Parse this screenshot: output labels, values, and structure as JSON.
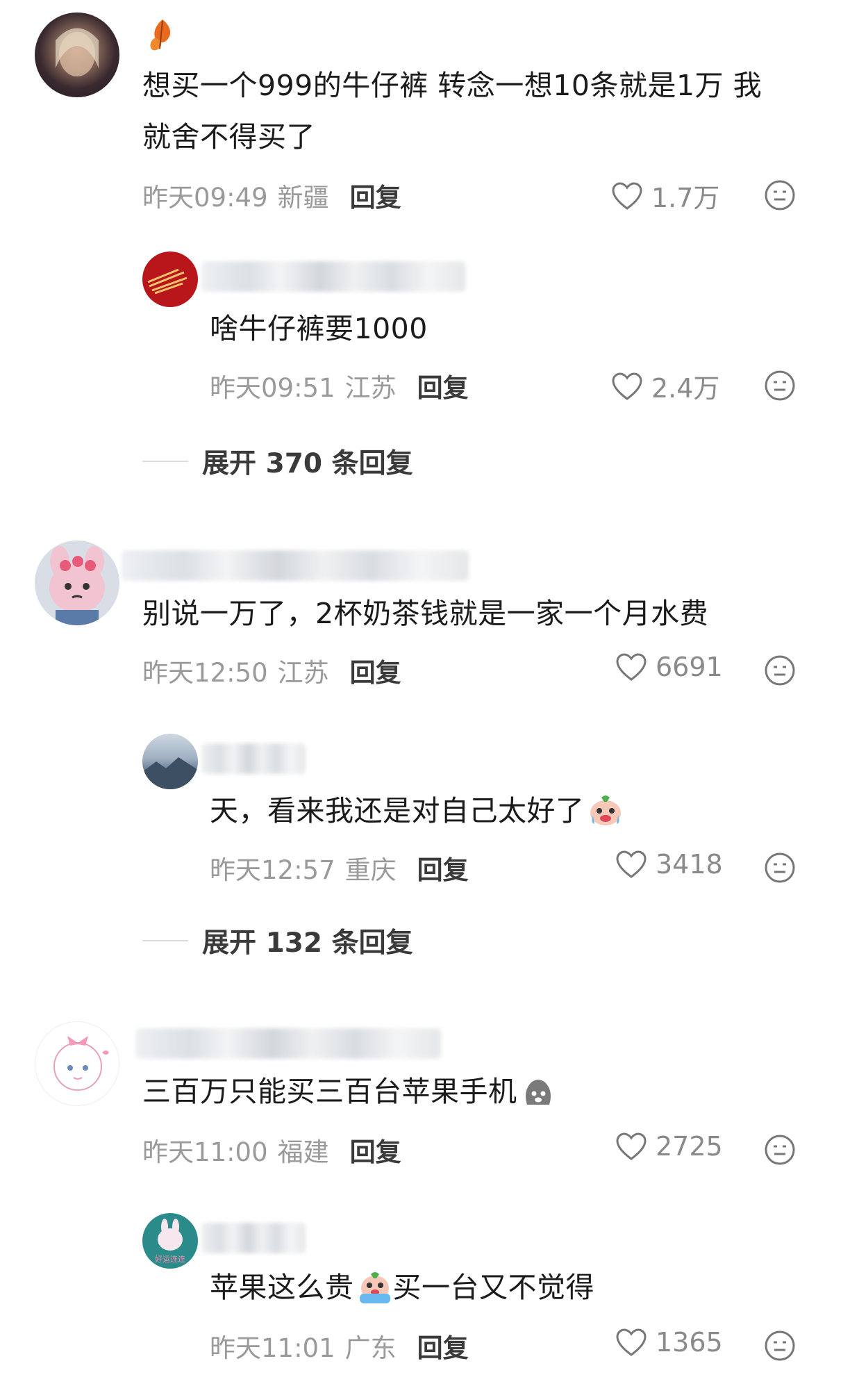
{
  "comments": [
    {
      "text": "想买一个999的牛仔裤 转念一想10条就是1万 我就舍不得买了",
      "line1": "想买一个999的牛仔裤 转念一想10条就是1万 我",
      "line2": "就舍不得买了",
      "time": "昨天09:49",
      "location": "新疆",
      "reply_label": "回复",
      "likes": "1.7万",
      "reply": {
        "text": "啥牛仔裤要1000",
        "time": "昨天09:51",
        "location": "江苏",
        "reply_label": "回复",
        "likes": "2.4万"
      },
      "expand_label": "展开 370 条回复"
    },
    {
      "text": "别说一万了，2杯奶茶钱就是一家一个月水费",
      "time": "昨天12:50",
      "location": "江苏",
      "reply_label": "回复",
      "likes": "6691",
      "reply": {
        "text": "天，看来我还是对自己太好了",
        "time": "昨天12:57",
        "location": "重庆",
        "reply_label": "回复",
        "likes": "3418"
      },
      "expand_label": "展开 132 条回复"
    },
    {
      "text": "三百万只能买三百台苹果手机",
      "time": "昨天11:00",
      "location": "福建",
      "reply_label": "回复",
      "likes": "2725",
      "reply": {
        "text_a": "苹果这么贵",
        "text_b": "买一台又不觉得",
        "time": "昨天11:01",
        "location": "广东",
        "reply_label": "回复",
        "likes": "1365",
        "avatar_caption": "好运连连"
      }
    }
  ],
  "icons": {
    "like": "heart-outline-icon",
    "react": "emoji-face-icon"
  },
  "colors": {
    "text": "#1b1b1b",
    "meta": "#9a9a9a",
    "reply": "#3a3a3a"
  }
}
